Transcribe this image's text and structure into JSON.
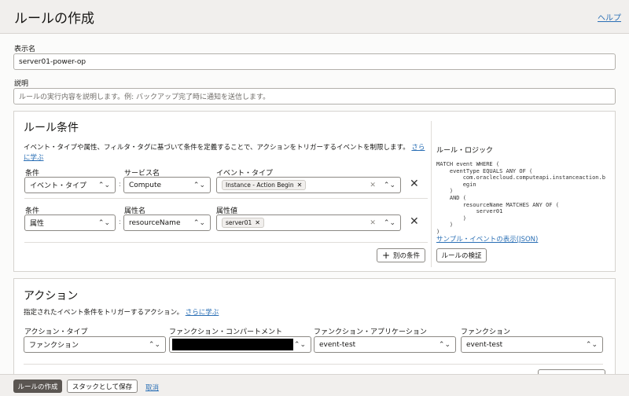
{
  "header": {
    "title": "ルールの作成",
    "help": "ヘルプ"
  },
  "display_name": {
    "label": "表示名",
    "value": "server01-power-op"
  },
  "description": {
    "label": "説明",
    "placeholder": "ルールの実行内容を説明します。例: バックアップ完了時に通知を送信します。"
  },
  "conditions": {
    "title": "ルール条件",
    "description": "イベント・タイプや属性、フィルタ・タグに基づいて条件を定義することで、アクションをトリガーするイベントを制限します。",
    "learn_more_1": "さら",
    "learn_more_2": "に学ぶ",
    "row1": {
      "condition_label": "条件",
      "condition_value": "イベント・タイプ",
      "service_label": "サービス名",
      "service_value": "Compute",
      "event_type_label": "イベント・タイプ",
      "event_type_tag": "Instance - Action Begin"
    },
    "row2": {
      "condition_label": "条件",
      "condition_value": "属性",
      "attr_name_label": "属性名",
      "attr_name_value": "resourceName",
      "attr_value_label": "属性値",
      "attr_value_tag": "server01"
    },
    "add_condition": "別の条件",
    "logic_title": "ルール・ロジック",
    "logic_code": "MATCH event WHERE (\n    eventType EQUALS ANY OF (\n        com.oraclecloud.computeapi.instanceaction.b\n        egin\n    )\n    AND (\n        resourceName MATCHES ANY OF (\n            server01\n        )\n    )\n)",
    "sample_event_link": "サンプル・イベントの表示(JSON)",
    "validate_button": "ルールの検証"
  },
  "actions": {
    "title": "アクション",
    "description": "指定されたイベント条件をトリガーするアクション。",
    "learn_more": "さらに学ぶ",
    "action_type_label": "アクション・タイプ",
    "action_type_value": "ファンクション",
    "compartment_label": "ファンクション・コンパートメント",
    "application_label": "ファンクション・アプリケーション",
    "application_value": "event-test",
    "function_label": "ファンクション",
    "function_value": "event-test"
  },
  "footer": {
    "create": "ルールの作成",
    "save_stack": "スタックとして保存",
    "cancel": "取消"
  }
}
